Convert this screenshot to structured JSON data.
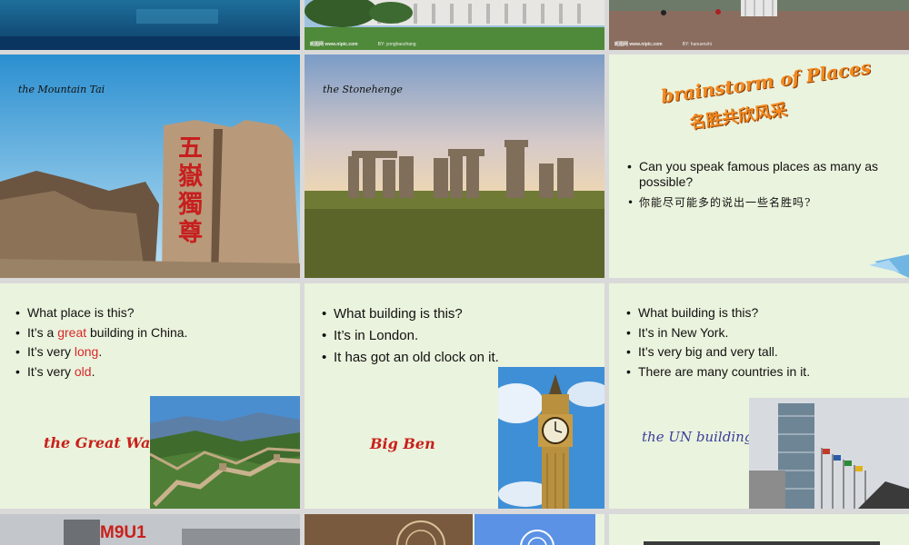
{
  "top_row": {
    "watermark_site": "昵图网 www.nipic.com",
    "slide2_author": "BY: yonghaozhang",
    "slide3_author": "BY: hanuenshi"
  },
  "tai": {
    "caption": "the Mountain Tai",
    "rock_text": "五嶽獨尊"
  },
  "stone": {
    "caption": "the Stonehenge"
  },
  "brainstorm": {
    "title_en": "brainstorm of Places",
    "title_cn": "名胜共欣风采",
    "bullet1": "Can you speak famous places as many as possible?",
    "bullet2": "你能尽可能多的说出一些名胜吗?"
  },
  "wall": {
    "b1": "What place is this?",
    "b2_pre": "It’s a ",
    "b2_hi": "great",
    "b2_post": " building in China.",
    "b3_pre": "It’s very ",
    "b3_hi": "long",
    "b3_post": ".",
    "b4_pre": "It’s very ",
    "b4_hi": "old",
    "b4_post": ".",
    "label": "the Great Wall"
  },
  "ben": {
    "b1": "What building is this?",
    "b2": "It’s in London.",
    "b3": "It has got an old clock on it.",
    "label": "Big Ben"
  },
  "un": {
    "b1": "What building is this?",
    "b2": "It’s in New York.",
    "b3": "It’s very big and very tall.",
    "b4": "There are many countries in it.",
    "label": "the UN building"
  },
  "bottom": {
    "badge": "M9U1"
  },
  "colors": {
    "slide_green": "#eaf3dd",
    "highlight_red": "#d9272b",
    "label_blue": "#3b3f9e"
  }
}
